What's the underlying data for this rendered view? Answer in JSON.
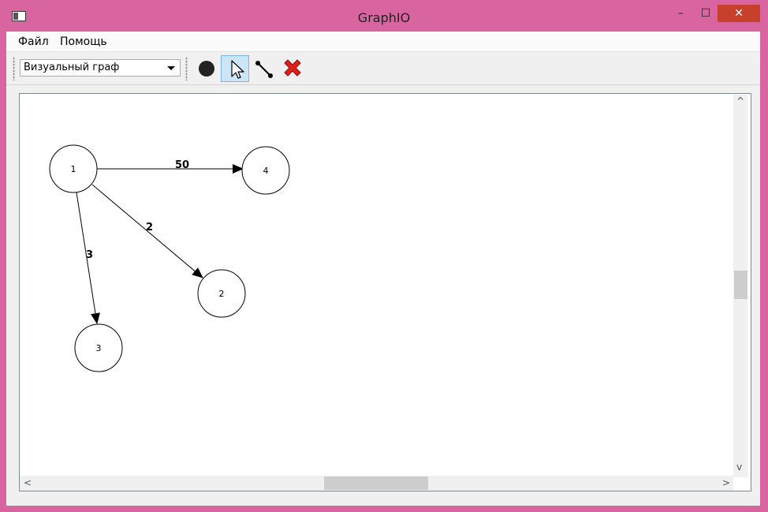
{
  "window": {
    "title": "GraphIO",
    "minimize": "–",
    "maximize": "☐",
    "close": "✕"
  },
  "menubar": {
    "file_label": "Файл",
    "help_label": "Помощь"
  },
  "toolbar": {
    "mode_select_value": "Визуальный граф",
    "tools": [
      {
        "name": "add-vertex-tool",
        "icon": "filled-circle-icon",
        "active": false
      },
      {
        "name": "select-tool",
        "icon": "cursor-arrow-icon",
        "active": true
      },
      {
        "name": "add-edge-tool",
        "icon": "edge-line-icon",
        "active": false
      },
      {
        "name": "delete-tool",
        "icon": "red-x-icon",
        "active": false
      }
    ]
  },
  "graph": {
    "vertices": [
      {
        "id": "1",
        "label": "1"
      },
      {
        "id": "2",
        "label": "2"
      },
      {
        "id": "3",
        "label": "3"
      },
      {
        "id": "4",
        "label": "4"
      }
    ],
    "edges": [
      {
        "from": "1",
        "to": "4",
        "weight": "50"
      },
      {
        "from": "1",
        "to": "2",
        "weight": "2"
      },
      {
        "from": "1",
        "to": "3",
        "weight": "3"
      }
    ]
  },
  "scrollbars": {
    "up": "^",
    "down": "v",
    "left": "<",
    "right": ">"
  }
}
